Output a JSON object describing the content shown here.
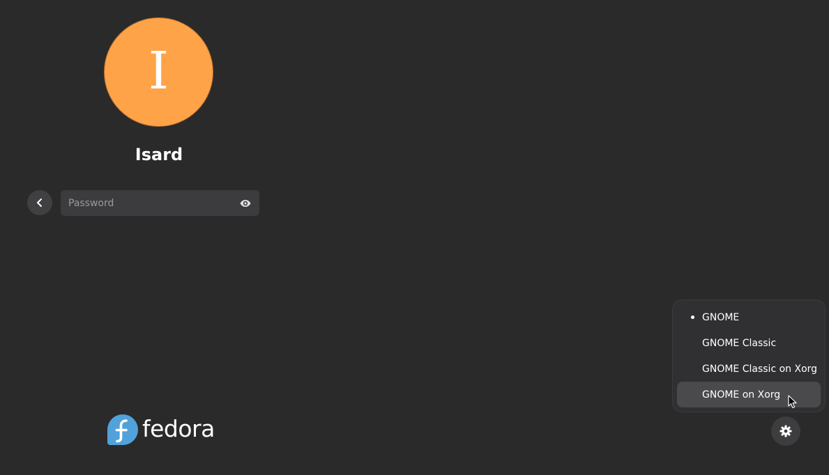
{
  "user": {
    "avatar_initial": "I",
    "avatar_color": "#ffa348",
    "name": "Isard"
  },
  "login": {
    "back_icon": "chevron-left-icon",
    "password_placeholder": "Password",
    "reveal_icon": "eye-icon"
  },
  "branding": {
    "wordmark": "fedora",
    "logo_color": "#51a2da"
  },
  "session_menu": {
    "items": [
      {
        "label": "GNOME",
        "selected": true
      },
      {
        "label": "GNOME Classic",
        "selected": false
      },
      {
        "label": "GNOME Classic on Xorg",
        "selected": false
      },
      {
        "label": "GNOME on Xorg",
        "selected": false,
        "hovered": true
      }
    ]
  },
  "settings": {
    "icon": "gear-icon"
  }
}
